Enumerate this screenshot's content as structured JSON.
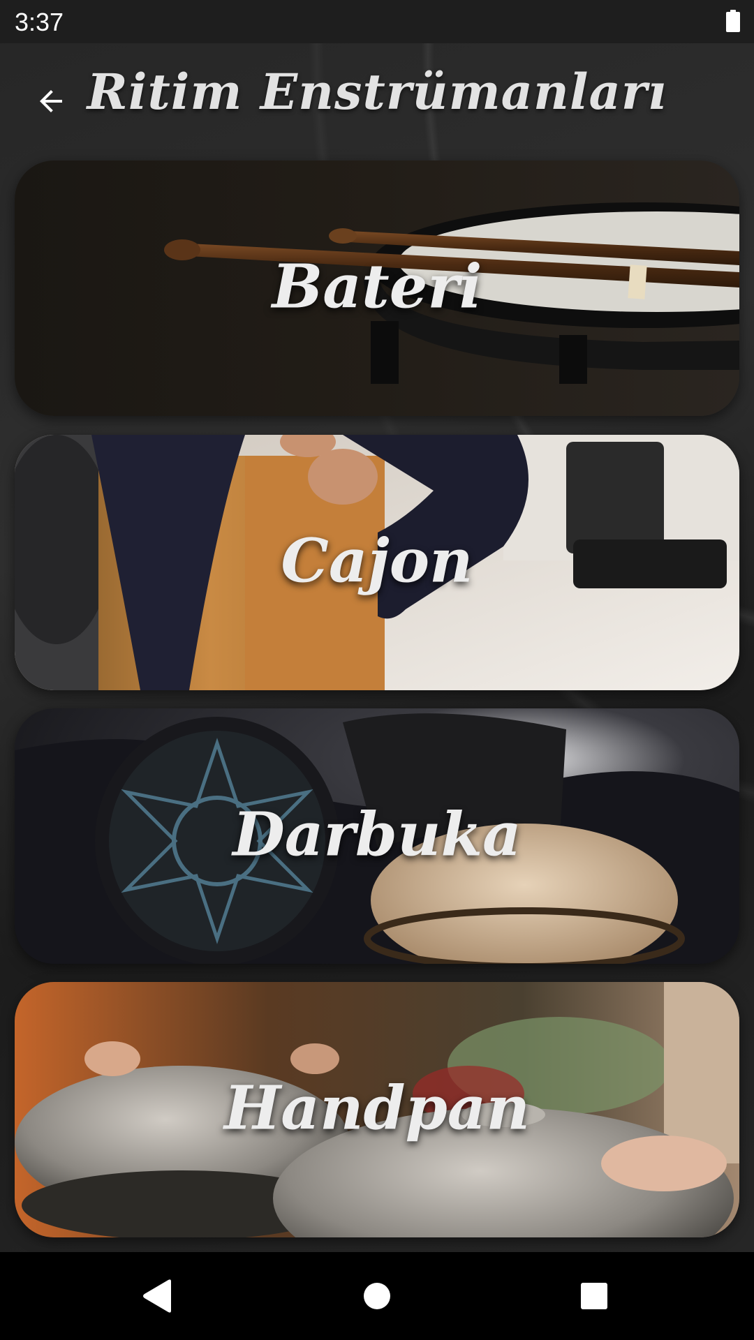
{
  "status_bar": {
    "time": "3:37",
    "battery_icon": "battery-full-icon"
  },
  "app_bar": {
    "back_icon": "arrow-back-icon",
    "title": "Ritim Enstrümanları"
  },
  "instruments": [
    {
      "label": "Bateri"
    },
    {
      "label": "Cajon"
    },
    {
      "label": "Darbuka"
    },
    {
      "label": "Handpan"
    }
  ],
  "nav_bar": {
    "back_icon": "triangle-back-icon",
    "home_icon": "circle-home-icon",
    "recents_icon": "square-recents-icon"
  },
  "colors": {
    "background": "#262626",
    "title_text": "#e2e2e2",
    "card_label": "#ededed",
    "nav_bar": "#000000"
  }
}
